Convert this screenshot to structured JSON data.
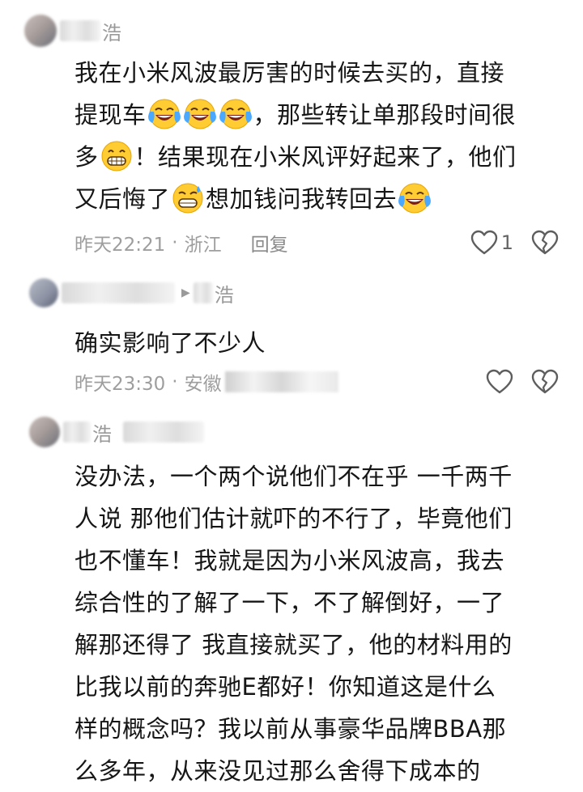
{
  "comments": [
    {
      "username": "浩",
      "lines": [
        "我在小米风波最厉害的时候去买的，直接",
        "提现车",
        "，那些转让单那段时间很",
        "多",
        "！结果现在小米风评好起来了，他们",
        "又后悔了",
        "想加钱问我转回去"
      ],
      "time": "昨天22:21",
      "location": "浙江",
      "reply_label": "回复",
      "like_count": "1"
    },
    {
      "username": "浩",
      "lines": [
        "确实影响了不少人"
      ],
      "time": "昨天23:30",
      "location": "安徽"
    },
    {
      "username": "浩",
      "lines": [
        "没办法，一个两个说他们不在乎 一千两千",
        "人说 那他们估计就吓的不行了，毕竟他们",
        "也不懂车！我就是因为小米风波高，我去",
        "综合性的了解了一下，不了解倒好，一了",
        "解那还得了 我直接就买了，他的材料用的",
        "比我以前的奔驰E都好！你知道这是什么",
        "样的概念吗？我以前从事豪华品牌BBA那",
        "么多年，从来没见过那么舍得下成本的"
      ]
    }
  ],
  "icons": {
    "like": "heart-outline-icon",
    "dislike": "broken-heart-icon",
    "laugh_cry": "laughing-crying-emoji",
    "grin": "grinning-emoji",
    "sweat_grin": "sweat-grin-emoji"
  },
  "colors": {
    "text": "#161616",
    "meta": "#9e9e9e",
    "emoji_face": "#ffcc33",
    "emoji_tears": "#4aa8ff"
  }
}
